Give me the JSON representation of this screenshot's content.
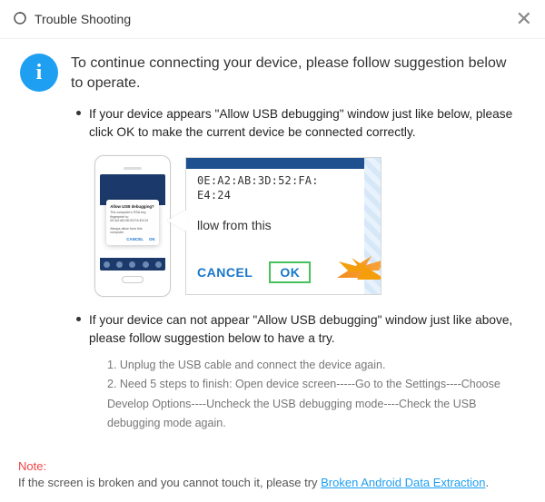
{
  "titlebar": {
    "title": "Trouble Shooting"
  },
  "headline": "To continue connecting your device, please follow suggestion below to operate.",
  "items": [
    {
      "text": "If your device appears \"Allow USB debugging\" window just like below, please click OK to make the current device  be connected correctly."
    },
    {
      "text": "If your device can not appear \"Allow USB debugging\" window just like above, please follow suggestion below to have a try."
    }
  ],
  "phone_dialog": {
    "title": "Allow USB debugging?",
    "body": "The computer's RSA key fingerprint is: 0E:A2:AB:3D:52:FA:E4:24",
    "check": "Always allow from this computer",
    "cancel": "CANCEL",
    "ok": "OK"
  },
  "zoom": {
    "mac1": "0E:A2:AB:3D:52:FA:",
    "mac2": "E4:24",
    "line1": "llow from this",
    "cancel": "CANCEL",
    "ok": "OK"
  },
  "sub_steps": {
    "s1": "1. Unplug the USB cable and connect the device again.",
    "s2": "2. Need 5 steps to finish: Open device screen-----Go to the Settings----Choose Develop Options----Uncheck the USB debugging mode----Check the USB debugging mode again."
  },
  "note": {
    "label": "Note:",
    "text": "If the screen is broken and you cannot touch it, please try ",
    "link": "Broken Android Data Extraction",
    "suffix": "."
  }
}
